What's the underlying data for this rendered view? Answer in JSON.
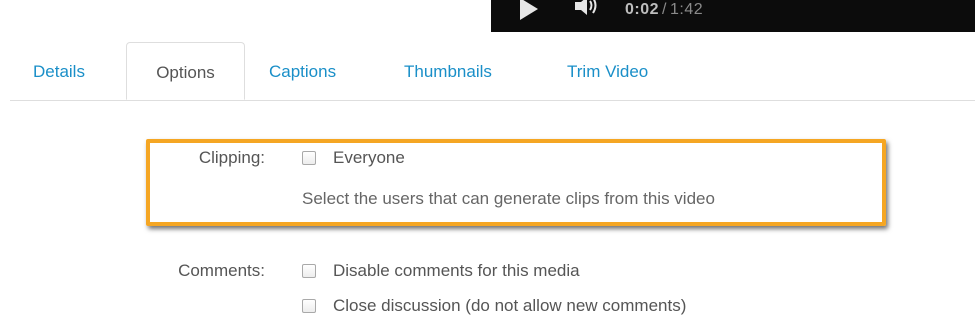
{
  "player": {
    "current_time": "0:02",
    "separator": "/",
    "total_time": "1:42"
  },
  "tabs": [
    {
      "label": "Details",
      "active": false
    },
    {
      "label": "Options",
      "active": true
    },
    {
      "label": "Captions",
      "active": false
    },
    {
      "label": "Thumbnails",
      "active": false
    },
    {
      "label": "Trim Video",
      "active": false
    }
  ],
  "clipping": {
    "label": "Clipping:",
    "option": "Everyone",
    "checked": false,
    "help": "Select the users that can generate clips from this video"
  },
  "comments": {
    "label": "Comments:",
    "options": [
      {
        "label": "Disable comments for this media",
        "checked": false
      },
      {
        "label": "Close discussion (do not allow new comments)",
        "checked": false
      }
    ]
  },
  "colors": {
    "tab_link": "#1a8fc8",
    "highlight": "#f5a623",
    "player_bg": "#0c0c0c"
  }
}
